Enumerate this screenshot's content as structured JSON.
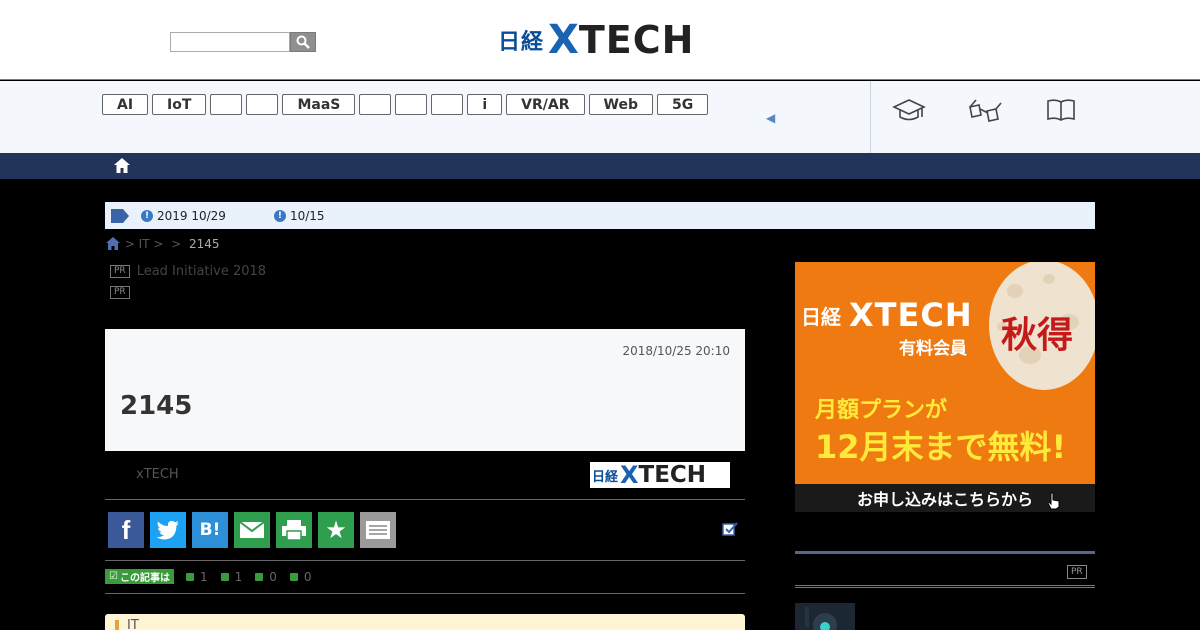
{
  "header": {
    "search": {
      "placeholder": "",
      "value": ""
    },
    "logo": {
      "nikkei": "日経",
      "x": "X",
      "tech": "TECH"
    }
  },
  "nav": {
    "tags": [
      {
        "label": "AI"
      },
      {
        "label": "IoT"
      },
      {
        "label": ""
      },
      {
        "label": ""
      },
      {
        "label": "MaaS"
      },
      {
        "label": ""
      },
      {
        "label": ""
      },
      {
        "label": ""
      },
      {
        "label": "i"
      },
      {
        "label": "VR/AR"
      },
      {
        "label": "Web"
      },
      {
        "label": "5G"
      }
    ],
    "arrow": "◀",
    "icons": [
      "graduation-cap-icon",
      "glasses-icon",
      "book-icon"
    ]
  },
  "notice": {
    "items": [
      {
        "text": "2019 10/29"
      },
      {
        "text": "10/15"
      }
    ]
  },
  "breadcrumb": {
    "path": " > IT > ",
    "sep": " > ",
    "last": "2145"
  },
  "pr_lines": [
    {
      "badge": "PR",
      "text": "Lead Initiative 2018"
    },
    {
      "badge": "PR",
      "text": ""
    }
  ],
  "article": {
    "date": "2018/10/25 20:10",
    "title": "2145",
    "byline": "xTECH",
    "byline_logo": {
      "nikkei": "日経",
      "x": "X",
      "tech": "TECH"
    }
  },
  "share": {
    "facebook": "f",
    "twitter": "",
    "hatena": "B!",
    "mail": "",
    "print": "",
    "favorite": "★",
    "memo": ""
  },
  "reactions": {
    "label": "この記事は",
    "counts": [
      "1",
      "1",
      "0",
      "0"
    ]
  },
  "category": {
    "text": "IT"
  },
  "ad": {
    "nikkei": "日経",
    "xtech": "XTECH",
    "member": "有料会員",
    "aki": "秋得",
    "line1": "月額プランが",
    "line2": "12月末まで無料!",
    "cta": "お申し込みはこちらから"
  },
  "sidebar": {
    "pr": "PR"
  },
  "colors": {
    "brand_blue": "#0b4c97",
    "bar_navy": "#22345a",
    "ad_orange": "#f07a12",
    "facebook": "#3b5998",
    "twitter": "#1da1f2",
    "hatena": "#2c8fd8",
    "green": "#2f9e4f"
  }
}
